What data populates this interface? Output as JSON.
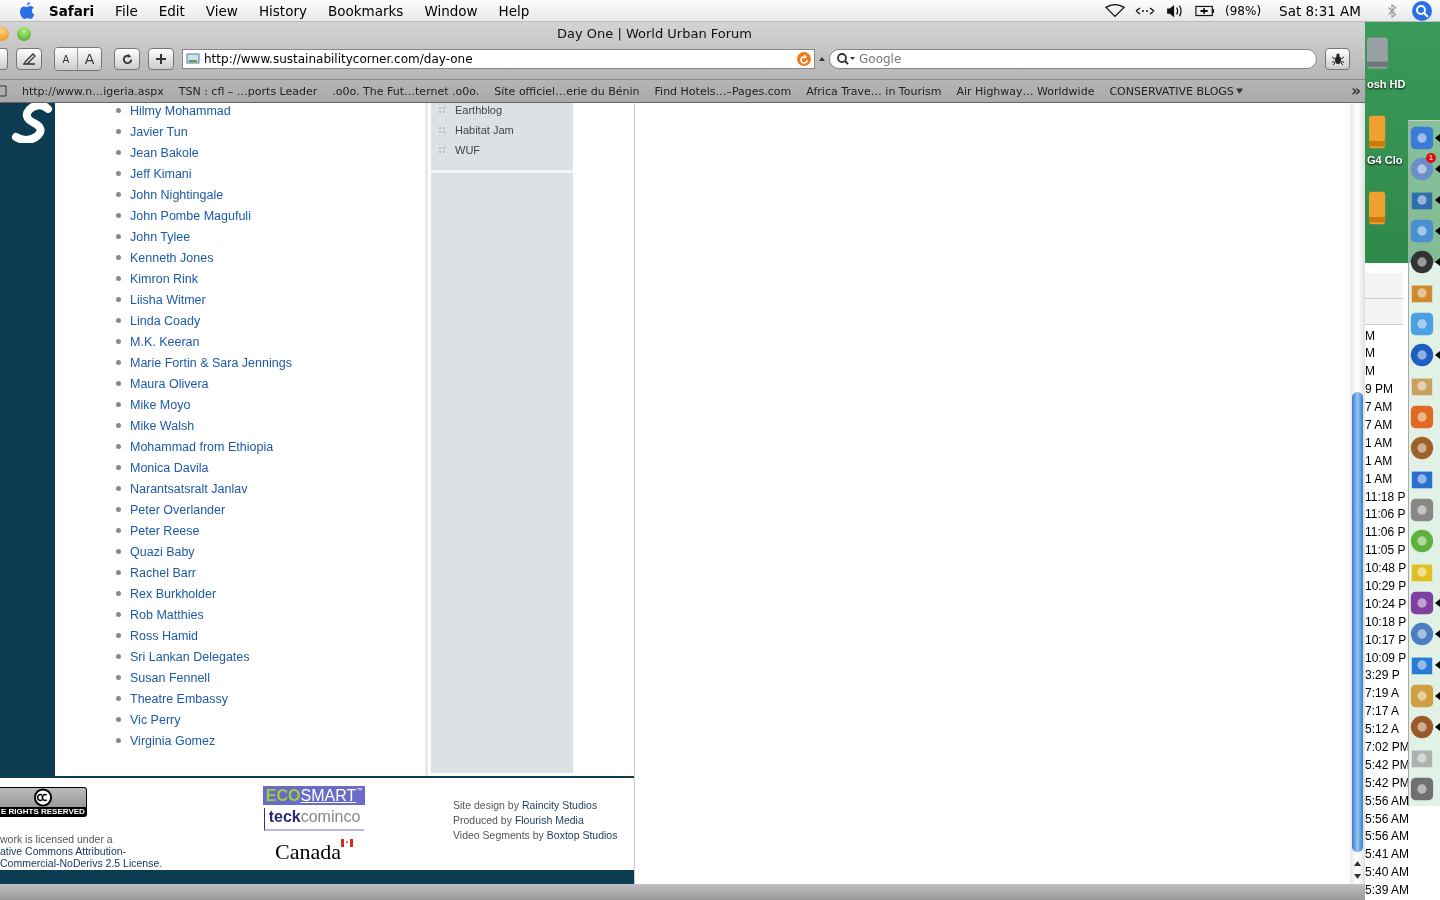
{
  "menu_bar": {
    "app": "Safari",
    "items": [
      "File",
      "Edit",
      "View",
      "History",
      "Bookmarks",
      "Window",
      "Help"
    ],
    "battery": "(98%)",
    "clock": "Sat 8:31 AM"
  },
  "window": {
    "title": "Day One | World Urban Forum"
  },
  "toolbar": {
    "text_size_buttons": [
      "A",
      "A"
    ],
    "address": "http://www.sustainabilitycorner.com/day-one",
    "search": {
      "placeholder": "Google"
    }
  },
  "bookmarks": [
    {
      "label": "http://www.n…igeria.aspx",
      "kind": "link"
    },
    {
      "label": "TSN : cfl – …ports Leader",
      "kind": "link"
    },
    {
      "label": ".o0o. The Fut…ternet .o0o.",
      "kind": "link"
    },
    {
      "label": "Site officiel…erie du Bénin",
      "kind": "link"
    },
    {
      "label": "Find Hotels…–Pages.com",
      "kind": "link"
    },
    {
      "label": "Africa Trave… in Tourism",
      "kind": "link"
    },
    {
      "label": "Air Highway… Worldwide",
      "kind": "link"
    },
    {
      "label": "CONSERVATIVE BLOGS",
      "kind": "folder"
    }
  ],
  "bookmarks_more": "»",
  "people": [
    "Hilmy Mohammad",
    "Javier Tun",
    "Jean Bakole",
    "Jeff Kimani",
    "John Nightingale",
    "John Pombe Magufuli",
    "John Tylee",
    "Kenneth Jones",
    "Kimron Rink",
    "Liisha Witmer",
    "Linda Coady",
    "M.K. Keeran",
    "Marie Fortin & Sara Jennings",
    "Maura Olivera",
    "Mike Moyo",
    "Mike Walsh",
    "Mohammad from Ethiopia",
    "Monica Davila",
    "Narantsatsralt Janlav",
    "Peter Overlander",
    "Peter Reese",
    "Quazi Baby",
    "Rachel Barr",
    "Rex Burkholder",
    "Rob Matthies",
    "Ross Hamid",
    "Sri Lankan Delegates",
    "Susan Fennell",
    "Theatre Embassy",
    "Vic Perry",
    "Virginia Gomez"
  ],
  "sidebar_links": [
    "Earthblog",
    "Habitat Jam",
    "WUF"
  ],
  "footer": {
    "license_badge": "E RIGHTS RESERVED",
    "license_text": "work is licensed under a",
    "license_link_lines": [
      "ative Commons Attribution-",
      "Commercial-NoDerivs 2.5 License"
    ],
    "license_end": ".",
    "ecosmart": {
      "eco": "ECO",
      "smart": "SMART",
      "tm": "™"
    },
    "teck": {
      "bold": "teck",
      "light": "cominco"
    },
    "canada": "Canada",
    "credits": [
      {
        "label": "Site design by",
        "link": "Raincity Studios"
      },
      {
        "label": "Produced by",
        "link": "Flourish Media"
      },
      {
        "label": "Video Segments by",
        "link": "Boxtop Studios"
      }
    ]
  },
  "desktop": {
    "drives": [
      "osh HD",
      "G4 Clo"
    ],
    "dock_badge": "1",
    "times": [
      "M",
      "M",
      "M",
      "9 PM",
      "7 AM",
      "7 AM",
      "1 AM",
      "1 AM",
      "1 AM",
      "11:18 P",
      "11:06 P",
      "11:06 P",
      "11:05 P",
      "10:48 P",
      "10:29 P",
      "10:24 P",
      "10:18 P",
      "10:17 P",
      "10:09 P",
      "3:29 P",
      "7:19 A",
      "7:17 A",
      "5:12 A",
      "7:02 PM",
      "5:42 PM",
      "5:42 PM",
      "5:56 AM",
      "5:56 AM",
      "5:56 AM",
      "5:41 AM",
      "5:40 AM",
      "5:39 AM"
    ]
  }
}
